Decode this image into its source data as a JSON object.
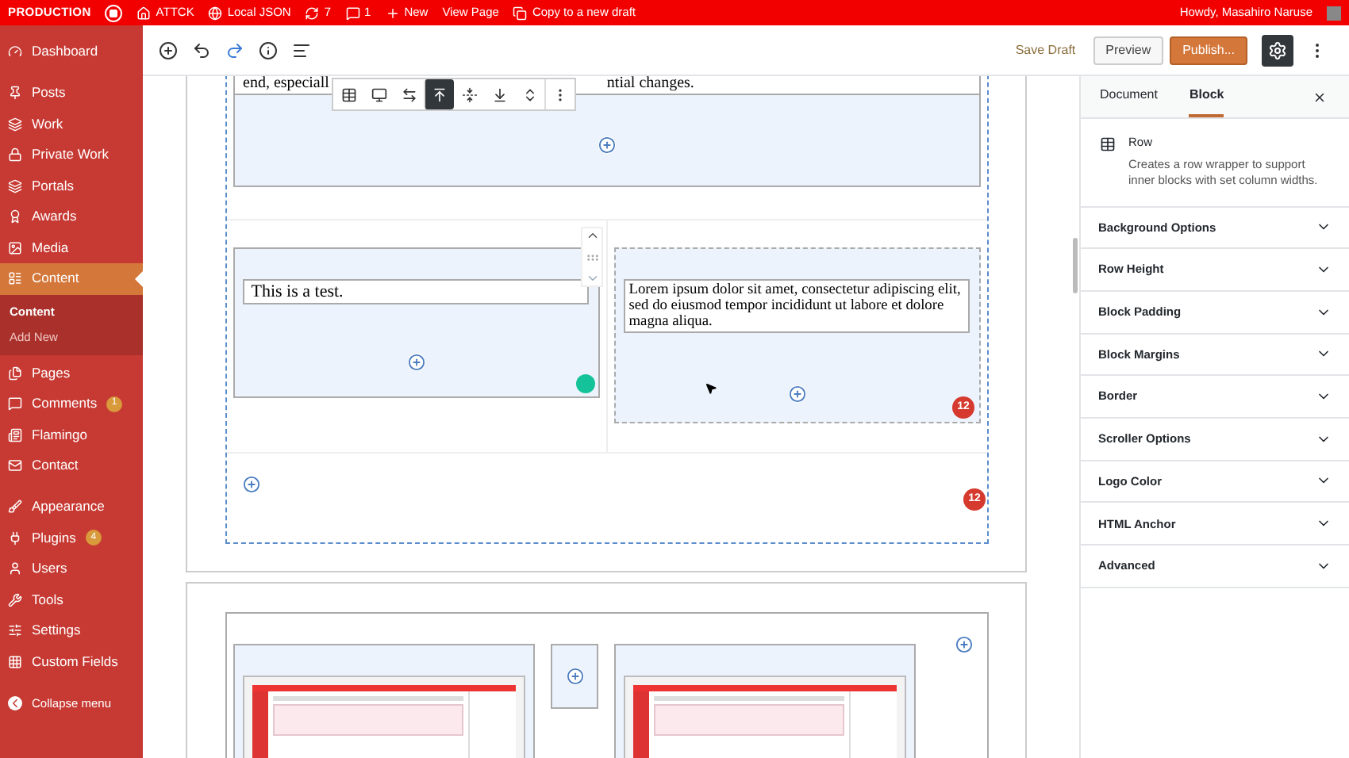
{
  "admin_bar": {
    "site_label": "PRODUCTION",
    "items": [
      {
        "label": "ATTCK"
      },
      {
        "label": "Local JSON"
      },
      {
        "label": "7"
      },
      {
        "label": "1"
      },
      {
        "label": "New"
      },
      {
        "label": "View Page"
      },
      {
        "label": "Copy to a new draft"
      }
    ],
    "account": "Howdy, Masahiro Naruse"
  },
  "sidebar": {
    "sections": [
      {
        "items": [
          {
            "label": "Dashboard",
            "selected": false
          }
        ]
      },
      {
        "items": [
          {
            "label": "Posts",
            "selected": false
          },
          {
            "label": "Work",
            "selected": false
          },
          {
            "label": "Private Work",
            "selected": false
          },
          {
            "label": "Portals",
            "selected": false
          },
          {
            "label": "Awards",
            "selected": false
          },
          {
            "label": "Media",
            "selected": false
          },
          {
            "label": "Content",
            "selected": true,
            "children": [
              {
                "label": "Content",
                "selected": true
              },
              {
                "label": "Add New",
                "selected": false
              }
            ]
          },
          {
            "label": "Pages",
            "selected": false
          },
          {
            "label": "Comments",
            "selected": false,
            "badge": "1"
          },
          {
            "label": "Flamingo",
            "selected": false
          },
          {
            "label": "Contact",
            "selected": false
          }
        ]
      },
      {
        "items": [
          {
            "label": "Appearance",
            "selected": false
          },
          {
            "label": "Plugins",
            "selected": false,
            "badge": "4"
          },
          {
            "label": "Users",
            "selected": false
          },
          {
            "label": "Tools",
            "selected": false
          },
          {
            "label": "Settings",
            "selected": false
          },
          {
            "label": "Custom Fields",
            "selected": false
          }
        ]
      }
    ],
    "collapse": "Collapse menu"
  },
  "editor_header": {
    "save_draft": "Save Draft",
    "preview": "Preview",
    "publish": "Publish...",
    "settings_open": true
  },
  "block_toolbar": [
    {
      "selected": false
    },
    {
      "selected": false
    },
    {
      "selected": false
    },
    {
      "selected": true
    },
    {
      "selected": false
    },
    {
      "selected": false
    },
    {
      "selected": false
    },
    {
      "selected": false
    }
  ],
  "canvas": {
    "top_block": {
      "text_before": "end, especiall",
      "text_after": "ntial changes."
    },
    "left_column": {
      "text": "This is a test."
    },
    "right_column": {
      "text": "Lorem ipsum dolor sit amet, consectetur adipiscing elit, sed do eiusmod tempor incididunt ut labore et dolore magna aliqua.",
      "badge": "12"
    },
    "row_badge": "12"
  },
  "settings": {
    "tabs": [
      {
        "label": "Document",
        "selected": false
      },
      {
        "label": "Block",
        "selected": true
      }
    ],
    "block": {
      "name": "Row",
      "description": "Creates a row wrapper to support inner blocks with set column widths."
    },
    "panels": [
      {
        "title": "Background Options",
        "expanded": false
      },
      {
        "title": "Row Height",
        "expanded": false
      },
      {
        "title": "Block Padding",
        "expanded": false
      },
      {
        "title": "Block Margins",
        "expanded": false
      },
      {
        "title": "Border",
        "expanded": false
      },
      {
        "title": "Scroller Options",
        "expanded": false
      },
      {
        "title": "Logo Color",
        "expanded": false
      },
      {
        "title": "HTML Anchor",
        "expanded": false
      },
      {
        "title": "Advanced",
        "expanded": false
      }
    ]
  }
}
